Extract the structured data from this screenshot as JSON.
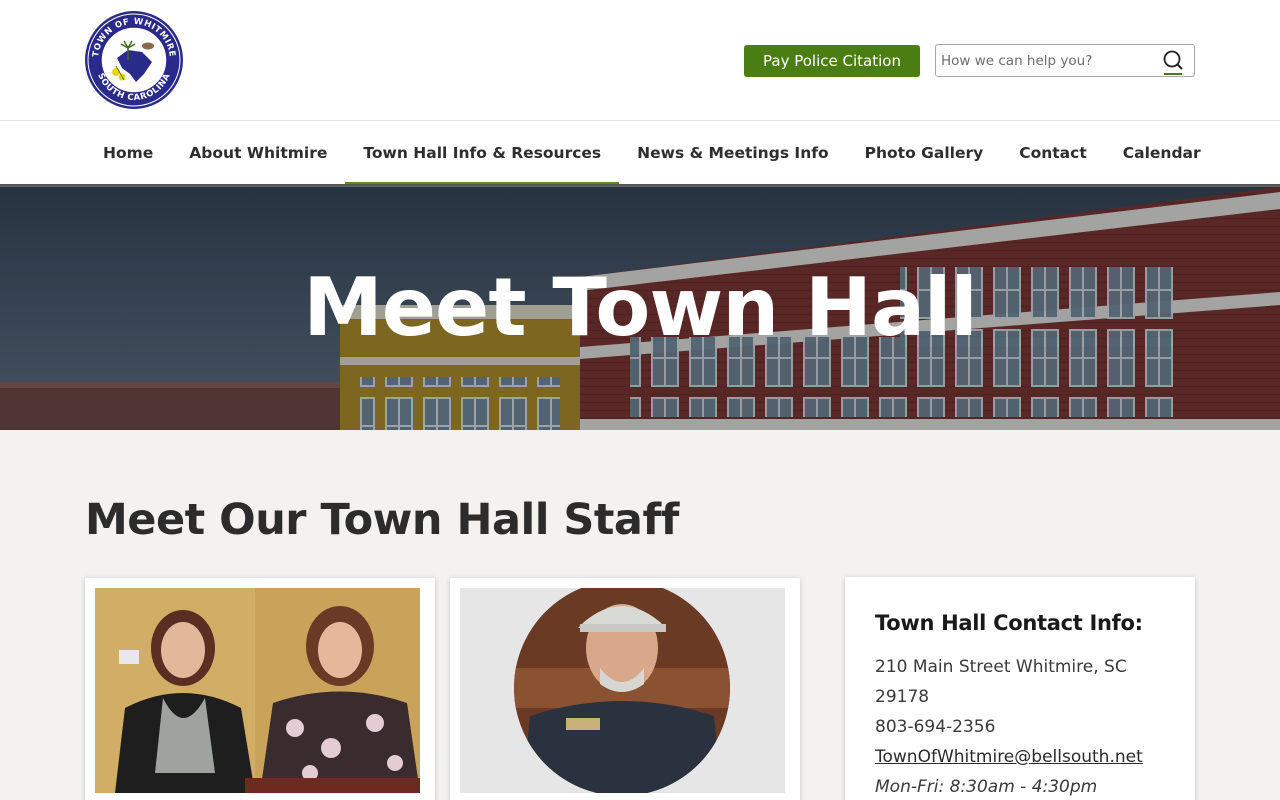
{
  "header": {
    "logo": {
      "ring_text_top": "TOWN OF WHITMIRE",
      "ring_text_bottom": "SOUTH CAROLINA"
    },
    "pay_button_label": "Pay Police Citation",
    "search": {
      "placeholder": "How we can help you?",
      "value": ""
    }
  },
  "nav": {
    "items": [
      {
        "label": "Home"
      },
      {
        "label": "About Whitmire"
      },
      {
        "label": "Town Hall Info & Resources"
      },
      {
        "label": "News & Meetings Info"
      },
      {
        "label": "Photo Gallery"
      },
      {
        "label": "Contact"
      },
      {
        "label": "Calendar"
      }
    ],
    "active_index": 2
  },
  "hero": {
    "title": "Meet Town Hall"
  },
  "main": {
    "section_title": "Meet Our Town Hall Staff"
  },
  "contact": {
    "title": "Town Hall Contact Info:",
    "address_line1": "210 Main Street Whitmire, SC",
    "address_line2": "29178",
    "phone": "803-694-2356",
    "email": "TownOfWhitmire@bellsouth.net",
    "hours": "Mon-Fri: 8:30am - 4:30pm"
  },
  "colors": {
    "brand_green": "#4a7d12",
    "nav_active": "#5c8a2b",
    "page_bg": "#f3f2f0"
  },
  "icons": {
    "search": "search-icon",
    "logo": "town-seal-logo"
  }
}
